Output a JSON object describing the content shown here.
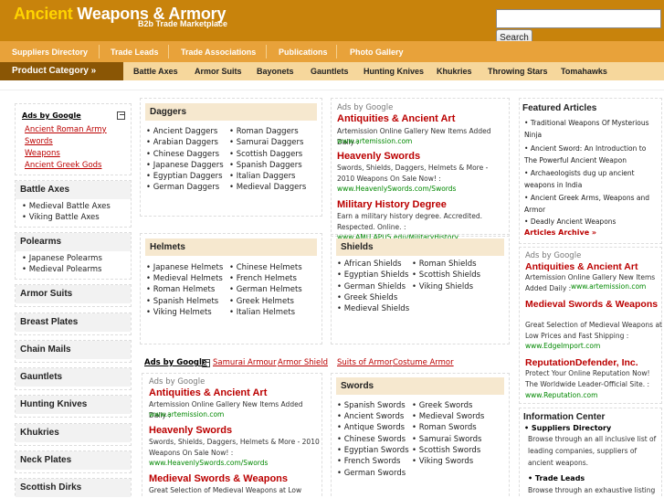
{
  "header": {
    "logo_word1": "Ancient",
    "logo_word2": "Weapons & Armory",
    "tagline": "B2b Trade Marketplace",
    "search_button": "Search",
    "search_value": ""
  },
  "topnav": [
    "Suppliers Directory",
    "Trade Leads",
    "Trade Associations",
    "Publications",
    "Photo Gallery"
  ],
  "category_bar": {
    "label": "Product Category »",
    "items": [
      "Battle Axes",
      "Armor Suits",
      "Bayonets",
      "Gauntlets",
      "Hunting Knives",
      "Khukries",
      "Throwing Stars",
      "Tomahawks"
    ]
  },
  "left_ads": {
    "title": "Ads by Google",
    "links": [
      "Ancient Roman Army",
      "Swords",
      "Weapons",
      "Ancient Greek Gods"
    ]
  },
  "left_categories": [
    {
      "title": "Battle Axes",
      "subs": [
        "Medieval Battle Axes",
        "Viking Battle Axes"
      ]
    },
    {
      "title": "Polearms",
      "subs": [
        "Japanese Polearms",
        "Medieval Polearms"
      ]
    },
    {
      "title": "Armor Suits",
      "subs": []
    },
    {
      "title": "Breast Plates",
      "subs": []
    },
    {
      "title": "Chain Mails",
      "subs": []
    },
    {
      "title": "Gauntlets",
      "subs": []
    },
    {
      "title": "Hunting Knives",
      "subs": []
    },
    {
      "title": "Khukries",
      "subs": []
    },
    {
      "title": "Neck Plates",
      "subs": []
    },
    {
      "title": "Scottish Dirks",
      "subs": []
    }
  ],
  "daggers": {
    "title": "Daggers",
    "col1": [
      "Ancient Daggers",
      "Arabian Daggers",
      "Chinese Daggers",
      "Japanese Daggers",
      "Egyptian Daggers",
      "German Daggers"
    ],
    "col2": [
      "Roman Daggers",
      "Samurai Daggers",
      "Scottish Daggers",
      "Spanish Daggers",
      "Italian Daggers",
      "Medieval Daggers"
    ]
  },
  "helmets": {
    "title": "Helmets",
    "col1": [
      "Japanese Helmets",
      "Medieval Helmets",
      "Roman Helmets",
      "Spanish Helmets",
      "Viking Helmets"
    ],
    "col2": [
      "Chinese Helmets",
      "French Helmets",
      "German Helmets",
      "Greek Helmets",
      "Italian Helmets"
    ]
  },
  "shields": {
    "title": "Shields",
    "col1": [
      "African Shields",
      "Egyptian Shields",
      "German Shields",
      "Greek Shields",
      "Medieval Shields"
    ],
    "col2": [
      "Roman Shields",
      "Scottish Shields",
      "Viking Shields"
    ]
  },
  "swords": {
    "title": "Swords",
    "col1": [
      "Spanish Swords",
      "Ancient Swords",
      "Antique Swords",
      "Chinese Swords",
      "Egyptian Swords",
      "French Swords",
      "German Swords"
    ],
    "col2": [
      "Greek Swords",
      "Medieval Swords",
      "Roman Swords",
      "Samurai Swords",
      "Scottish Swords",
      "Viking Swords"
    ]
  },
  "mid_ads_top": {
    "label": "Ads by Google",
    "ads": [
      {
        "title": "Antiquities & Ancient Art",
        "text": "Artemission Online Gallery New Items Added Daily :",
        "url": "www.artemission.com"
      },
      {
        "title": "Heavenly Swords",
        "text": "Swords, Shields, Daggers, Helmets & More - 2010 Weapons On Sale Now! :",
        "url": "www.HeavenlySwords.com/Swords"
      },
      {
        "title": "Military History Degree",
        "text": "Earn a military history degree. Accredited. Respected. Online. :",
        "url": "www.AMU.APUS.edu/MilitaryHistory"
      }
    ]
  },
  "ads_line": {
    "title": "Ads by Google",
    "links": [
      "Samurai Armour",
      "Armor Shield",
      "Suits of Armor",
      "Costume Armor"
    ]
  },
  "mid_ads_bottom": {
    "label": "Ads by Google",
    "ads": [
      {
        "title": "Antiquities & Ancient Art",
        "text": "Artemission Online Gallery New Items Added Daily :",
        "url": "www.artemission.com"
      },
      {
        "title": "Heavenly Swords",
        "text": "Swords, Shields, Daggers, Helmets & More - 2010 Weapons On Sale Now! :",
        "url": "www.HeavenlySwords.com/Swords"
      },
      {
        "title": "Medieval Swords & Weapons",
        "text": "Great Selection of Medieval Weapons at Low Prices",
        "url": ""
      }
    ]
  },
  "featured": {
    "title": "Featured Articles",
    "items": [
      "Traditional Weapons Of Mysterious Ninja",
      "Ancient Sword: An Introduction to The Powerful Ancient Weapon",
      "Archaeologists dug up ancient weapons in India",
      "Ancient Greek Arms, Weapons and Armor",
      "Deadly Ancient Weapons"
    ],
    "archive_link": "Articles Archive »"
  },
  "right_ads": {
    "label": "Ads by Google",
    "ads": [
      {
        "title": "Antiquities & Ancient Art",
        "text": "Artemission Online Gallery New Items Added Daily :",
        "url": "www.artemission.com"
      },
      {
        "title": "Medieval Swords & Weapons",
        "text": "Great Selection of Medieval Weapons at Low Prices and Fast Shipping :",
        "url": "www.EdgeImport.com"
      },
      {
        "title": "ReputationDefender, Inc.",
        "text": "Protect Your Online Reputation Now! The Worldwide Leader-Official Site. :",
        "url": "www.Reputation.com"
      }
    ]
  },
  "info_center": {
    "title": "Information Center",
    "sections": [
      {
        "title": "Suppliers Directory",
        "text": "Browse through an all inclusive list of leading companies, suppliers of ancient weapons."
      },
      {
        "title": "Trade Leads",
        "text": "Browse through an exhaustive listing of"
      }
    ]
  }
}
